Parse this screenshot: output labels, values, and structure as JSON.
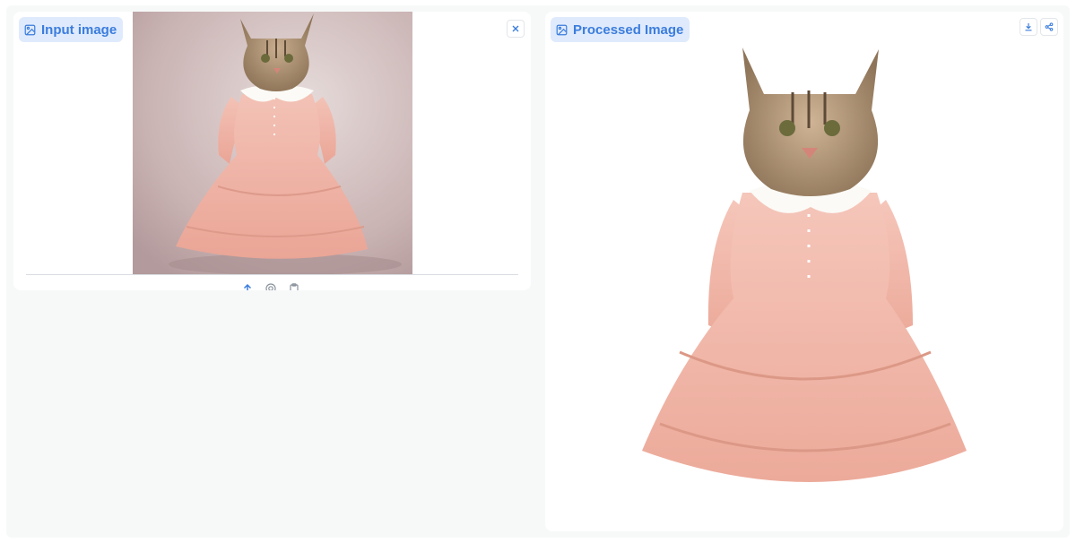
{
  "input_panel": {
    "label": "Input image",
    "label_icon": "image-icon",
    "clear_icon": "close-icon",
    "image_description_icon": "cat-in-pink-dress-photo",
    "source_icons": [
      "upload-icon",
      "webcam-icon",
      "clipboard-icon"
    ]
  },
  "output_panel": {
    "label": "Processed Image",
    "label_icon": "image-icon",
    "action_icons": [
      "download-icon",
      "share-icon"
    ]
  },
  "colors": {
    "accent": "#3b7ddd",
    "chip_bg": "#dfeafc",
    "page_bg": "#f7f9f9",
    "dress": "#f2b7a8",
    "cat_fur": "#a88a6a"
  }
}
